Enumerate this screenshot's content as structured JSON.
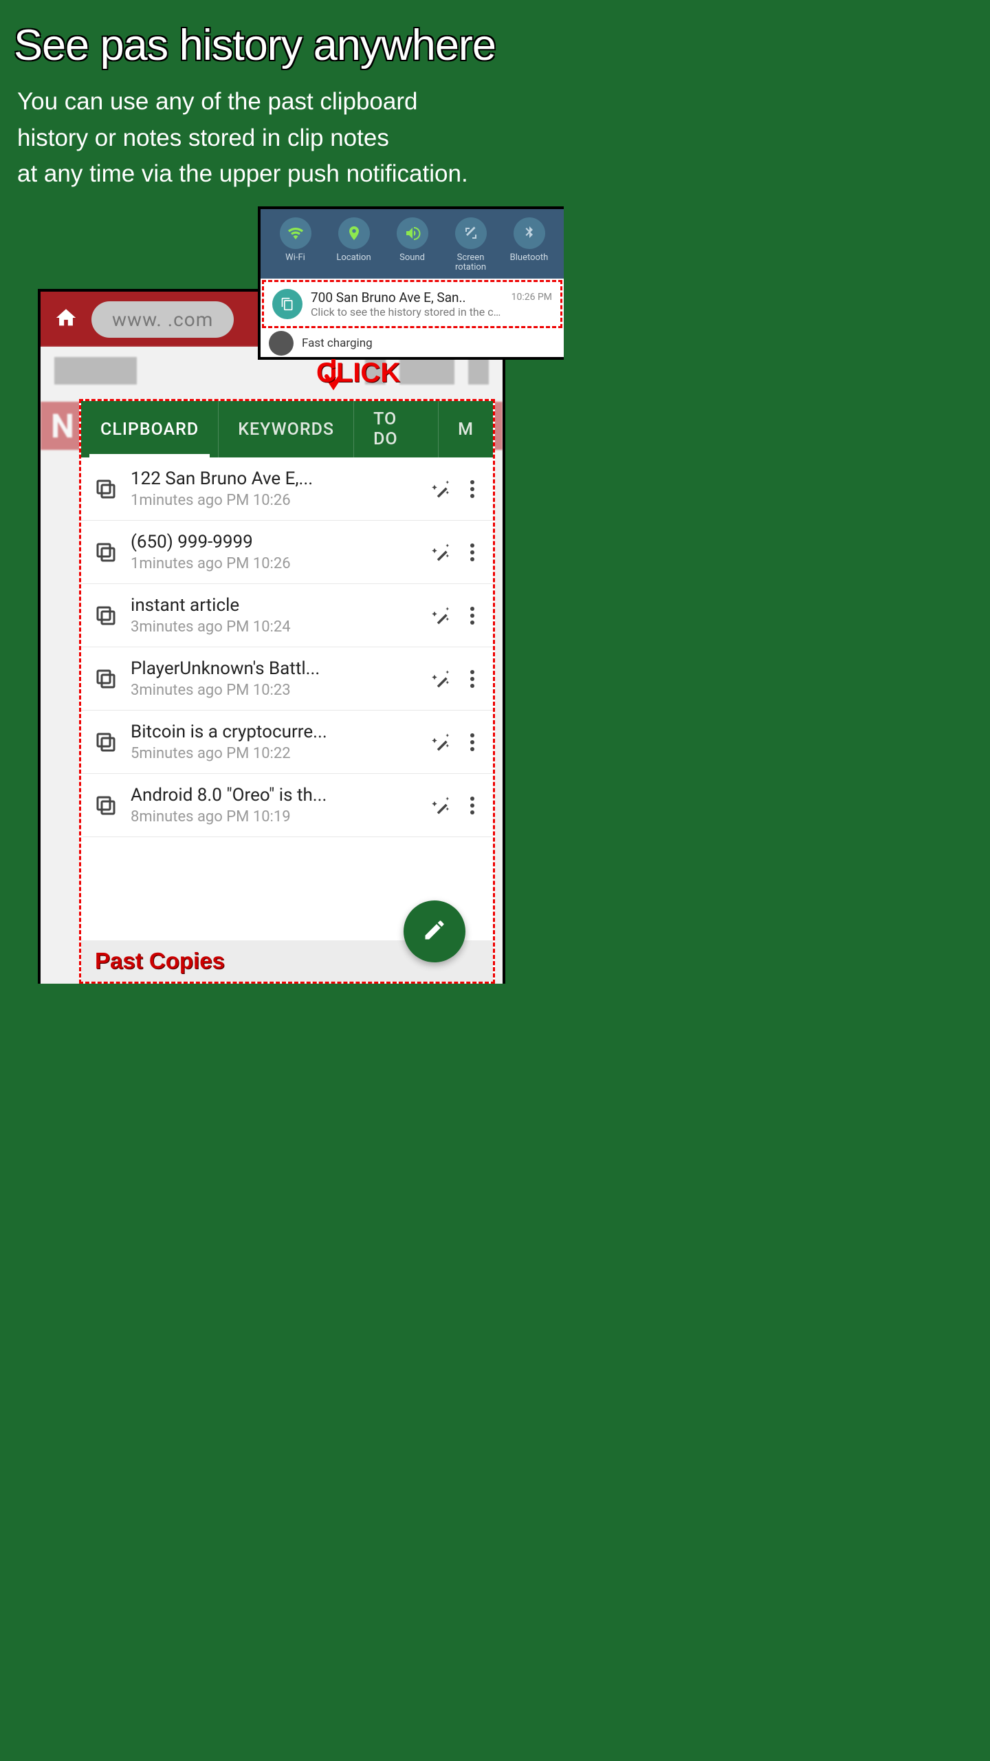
{
  "headline": "See pas history anywhere",
  "subtext_lines": [
    "You can use any of the past clipboard",
    "history or notes stored in clip notes",
    "at any time via the upper push notification."
  ],
  "quick_settings": [
    {
      "label": "Wi-Fi",
      "icon": "wifi",
      "active": true
    },
    {
      "label": "Location",
      "icon": "location",
      "active": true
    },
    {
      "label": "Sound",
      "icon": "sound",
      "active": true
    },
    {
      "label": "Screen rotation",
      "icon": "rotate",
      "active": false
    },
    {
      "label": "Bluetooth",
      "icon": "bluetooth",
      "active": false
    }
  ],
  "notification": {
    "title": "700 San Bruno Ave E, San..",
    "subtitle": "Click to see the history stored in the clipbo..",
    "time": "10:26 PM"
  },
  "fast_charging": "Fast charging",
  "click_label": "CLICK",
  "browser": {
    "url": "www.       .com",
    "n_letter": "N"
  },
  "tabs": [
    "CLIPBOARD",
    "KEYWORDS",
    "TO DO",
    "M"
  ],
  "active_tab": 0,
  "clips": [
    {
      "title": "122 San Bruno Ave E,...",
      "time": "1minutes ago PM 10:26"
    },
    {
      "title": "(650) 999-9999",
      "time": "1minutes ago PM 10:26"
    },
    {
      "title": "instant article",
      "time": "3minutes ago PM 10:24"
    },
    {
      "title": "PlayerUnknown's Battl...",
      "time": "3minutes ago PM 10:23"
    },
    {
      "title": "Bitcoin is a cryptocurre...",
      "time": "5minutes ago PM 10:22"
    },
    {
      "title": "Android 8.0 \"Oreo\" is th...",
      "time": "8minutes ago PM 10:19"
    }
  ],
  "past_copies_label": "Past Copies"
}
